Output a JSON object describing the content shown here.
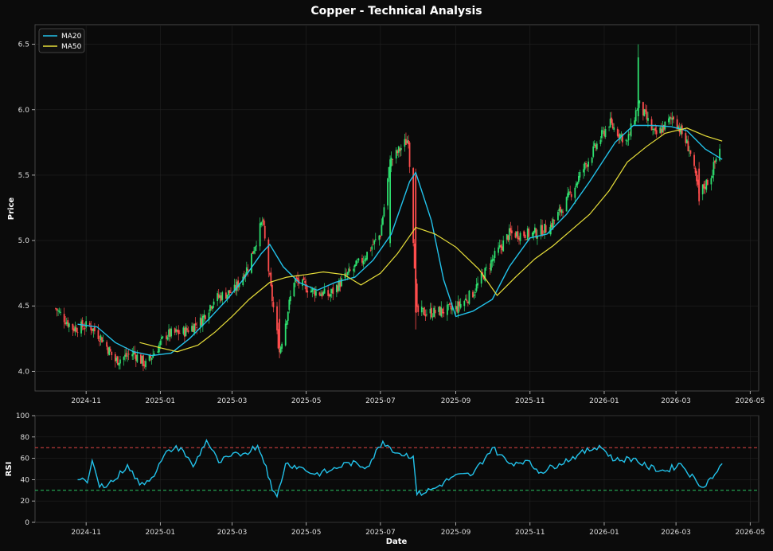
{
  "chart_data": [
    {
      "type": "candlestick",
      "title": "Copper - Technical Analysis",
      "xlabel": "",
      "ylabel": "Price",
      "x_tick_labels": [
        "2024-11",
        "2025-01",
        "2025-03",
        "2025-05",
        "2025-07",
        "2025-09",
        "2025-11",
        "2026-01",
        "2026-03",
        "2026-05"
      ],
      "y_ticks": [
        4.0,
        4.5,
        5.0,
        5.5,
        6.0,
        6.5
      ],
      "ylim": [
        3.85,
        6.65
      ],
      "xlim": [
        "2024-09-20",
        "2026-05-08"
      ],
      "grid": true,
      "legend": {
        "placement": "top-left",
        "entries": [
          "MA20",
          "MA50"
        ]
      },
      "colors": {
        "up": "#2ee06f",
        "down": "#ff4d4d",
        "MA20": "#22c2ea",
        "MA50": "#e8df3a"
      },
      "price_close_approx": [
        [
          "2024-10-07",
          4.48
        ],
        [
          "2024-10-21",
          4.33
        ],
        [
          "2024-11-04",
          4.35
        ],
        [
          "2024-11-14",
          4.25
        ],
        [
          "2024-11-25",
          4.08
        ],
        [
          "2024-12-10",
          4.14
        ],
        [
          "2024-12-20",
          4.05
        ],
        [
          "2025-01-06",
          4.28
        ],
        [
          "2025-01-20",
          4.3
        ],
        [
          "2025-02-03",
          4.38
        ],
        [
          "2025-02-14",
          4.55
        ],
        [
          "2025-03-03",
          4.62
        ],
        [
          "2025-03-14",
          4.8
        ],
        [
          "2025-03-26",
          5.15
        ],
        [
          "2025-04-03",
          4.55
        ],
        [
          "2025-04-09",
          4.15
        ],
        [
          "2025-04-21",
          4.7
        ],
        [
          "2025-05-05",
          4.62
        ],
        [
          "2025-05-20",
          4.58
        ],
        [
          "2025-06-02",
          4.72
        ],
        [
          "2025-06-16",
          4.85
        ],
        [
          "2025-07-01",
          5.05
        ],
        [
          "2025-07-09",
          5.6
        ],
        [
          "2025-07-24",
          5.78
        ],
        [
          "2025-07-31",
          4.45
        ],
        [
          "2025-08-14",
          4.45
        ],
        [
          "2025-09-01",
          4.48
        ],
        [
          "2025-09-15",
          4.6
        ],
        [
          "2025-10-01",
          4.85
        ],
        [
          "2025-10-15",
          5.05
        ],
        [
          "2025-11-03",
          5.05
        ],
        [
          "2025-11-17",
          5.1
        ],
        [
          "2025-12-01",
          5.3
        ],
        [
          "2025-12-15",
          5.55
        ],
        [
          "2026-01-05",
          5.9
        ],
        [
          "2026-01-20",
          5.75
        ],
        [
          "2026-01-29",
          6.05
        ],
        [
          "2026-02-12",
          5.8
        ],
        [
          "2026-02-27",
          5.95
        ],
        [
          "2026-03-12",
          5.7
        ],
        [
          "2026-03-20",
          5.35
        ],
        [
          "2026-03-30",
          5.5
        ],
        [
          "2026-04-07",
          5.75
        ]
      ],
      "series": [
        {
          "name": "MA20",
          "points": [
            [
              "2024-10-25",
              4.36
            ],
            [
              "2024-11-10",
              4.34
            ],
            [
              "2024-11-25",
              4.22
            ],
            [
              "2024-12-10",
              4.15
            ],
            [
              "2024-12-25",
              4.12
            ],
            [
              "2025-01-10",
              4.14
            ],
            [
              "2025-01-25",
              4.25
            ],
            [
              "2025-02-10",
              4.4
            ],
            [
              "2025-02-25",
              4.55
            ],
            [
              "2025-03-10",
              4.7
            ],
            [
              "2025-03-25",
              4.9
            ],
            [
              "2025-04-01",
              4.97
            ],
            [
              "2025-04-12",
              4.8
            ],
            [
              "2025-04-25",
              4.68
            ],
            [
              "2025-05-10",
              4.62
            ],
            [
              "2025-05-25",
              4.68
            ],
            [
              "2025-06-10",
              4.72
            ],
            [
              "2025-06-25",
              4.85
            ],
            [
              "2025-07-10",
              5.05
            ],
            [
              "2025-07-25",
              5.45
            ],
            [
              "2025-07-30",
              5.52
            ],
            [
              "2025-08-12",
              5.15
            ],
            [
              "2025-08-22",
              4.7
            ],
            [
              "2025-09-01",
              4.42
            ],
            [
              "2025-09-15",
              4.46
            ],
            [
              "2025-10-01",
              4.55
            ],
            [
              "2025-10-15",
              4.8
            ],
            [
              "2025-11-01",
              5.02
            ],
            [
              "2025-11-15",
              5.05
            ],
            [
              "2025-12-01",
              5.2
            ],
            [
              "2025-12-20",
              5.45
            ],
            [
              "2026-01-10",
              5.75
            ],
            [
              "2026-01-25",
              5.88
            ],
            [
              "2026-02-10",
              5.88
            ],
            [
              "2026-02-25",
              5.87
            ],
            [
              "2026-03-10",
              5.84
            ],
            [
              "2026-03-25",
              5.7
            ],
            [
              "2026-04-08",
              5.62
            ]
          ]
        },
        {
          "name": "MA50",
          "points": [
            [
              "2024-12-15",
              4.22
            ],
            [
              "2025-01-01",
              4.18
            ],
            [
              "2025-01-15",
              4.15
            ],
            [
              "2025-02-01",
              4.2
            ],
            [
              "2025-02-15",
              4.3
            ],
            [
              "2025-03-01",
              4.42
            ],
            [
              "2025-03-15",
              4.55
            ],
            [
              "2025-04-01",
              4.68
            ],
            [
              "2025-04-15",
              4.72
            ],
            [
              "2025-05-01",
              4.74
            ],
            [
              "2025-05-15",
              4.76
            ],
            [
              "2025-06-01",
              4.74
            ],
            [
              "2025-06-15",
              4.66
            ],
            [
              "2025-07-01",
              4.75
            ],
            [
              "2025-07-15",
              4.9
            ],
            [
              "2025-07-30",
              5.1
            ],
            [
              "2025-08-15",
              5.05
            ],
            [
              "2025-09-01",
              4.95
            ],
            [
              "2025-09-20",
              4.78
            ],
            [
              "2025-10-05",
              4.58
            ],
            [
              "2025-10-20",
              4.72
            ],
            [
              "2025-11-05",
              4.86
            ],
            [
              "2025-11-20",
              4.96
            ],
            [
              "2025-12-05",
              5.08
            ],
            [
              "2025-12-20",
              5.2
            ],
            [
              "2026-01-05",
              5.38
            ],
            [
              "2026-01-20",
              5.6
            ],
            [
              "2026-02-05",
              5.72
            ],
            [
              "2026-02-20",
              5.82
            ],
            [
              "2026-03-10",
              5.86
            ],
            [
              "2026-03-25",
              5.8
            ],
            [
              "2026-04-08",
              5.76
            ]
          ]
        }
      ]
    },
    {
      "type": "line",
      "title": "",
      "xlabel": "Date",
      "ylabel": "RSI",
      "x_tick_labels": [
        "2024-11",
        "2025-01",
        "2025-03",
        "2025-05",
        "2025-07",
        "2025-09",
        "2025-11",
        "2026-01",
        "2026-03",
        "2026-05"
      ],
      "y_ticks": [
        0,
        20,
        40,
        60,
        80,
        100
      ],
      "ylim": [
        0,
        100
      ],
      "grid": true,
      "reference_lines": [
        {
          "value": 70,
          "color": "#ff4d4d",
          "style": "dashed"
        },
        {
          "value": 30,
          "color": "#2ee06f",
          "style": "dashed"
        }
      ],
      "series": [
        {
          "name": "",
          "color": "#22c2ea",
          "points": [
            [
              "2024-10-25",
              40
            ],
            [
              "2024-11-02",
              37
            ],
            [
              "2024-11-06",
              58
            ],
            [
              "2024-11-12",
              33
            ],
            [
              "2024-11-25",
              40
            ],
            [
              "2024-12-05",
              54
            ],
            [
              "2024-12-15",
              35
            ],
            [
              "2024-12-25",
              42
            ],
            [
              "2025-01-08",
              68
            ],
            [
              "2025-01-18",
              70
            ],
            [
              "2025-01-28",
              52
            ],
            [
              "2025-02-08",
              77
            ],
            [
              "2025-02-18",
              56
            ],
            [
              "2025-02-28",
              62
            ],
            [
              "2025-03-12",
              65
            ],
            [
              "2025-03-22",
              72
            ],
            [
              "2025-03-29",
              53
            ],
            [
              "2025-04-03",
              30
            ],
            [
              "2025-04-07",
              24
            ],
            [
              "2025-04-14",
              55
            ],
            [
              "2025-04-25",
              52
            ],
            [
              "2025-05-08",
              45
            ],
            [
              "2025-05-20",
              48
            ],
            [
              "2025-06-05",
              56
            ],
            [
              "2025-06-20",
              52
            ],
            [
              "2025-07-03",
              76
            ],
            [
              "2025-07-15",
              65
            ],
            [
              "2025-07-28",
              62
            ],
            [
              "2025-07-31",
              26
            ],
            [
              "2025-08-15",
              32
            ],
            [
              "2025-08-30",
              43
            ],
            [
              "2025-09-15",
              45
            ],
            [
              "2025-10-01",
              70
            ],
            [
              "2025-10-15",
              55
            ],
            [
              "2025-10-28",
              58
            ],
            [
              "2025-11-10",
              47
            ],
            [
              "2025-11-25",
              55
            ],
            [
              "2025-12-10",
              63
            ],
            [
              "2025-12-28",
              72
            ],
            [
              "2026-01-10",
              58
            ],
            [
              "2026-01-25",
              60
            ],
            [
              "2026-02-05",
              52
            ],
            [
              "2026-02-20",
              48
            ],
            [
              "2026-03-05",
              55
            ],
            [
              "2026-03-18",
              38
            ],
            [
              "2026-03-22",
              33
            ],
            [
              "2026-04-02",
              45
            ],
            [
              "2026-04-08",
              55
            ]
          ]
        }
      ]
    }
  ]
}
